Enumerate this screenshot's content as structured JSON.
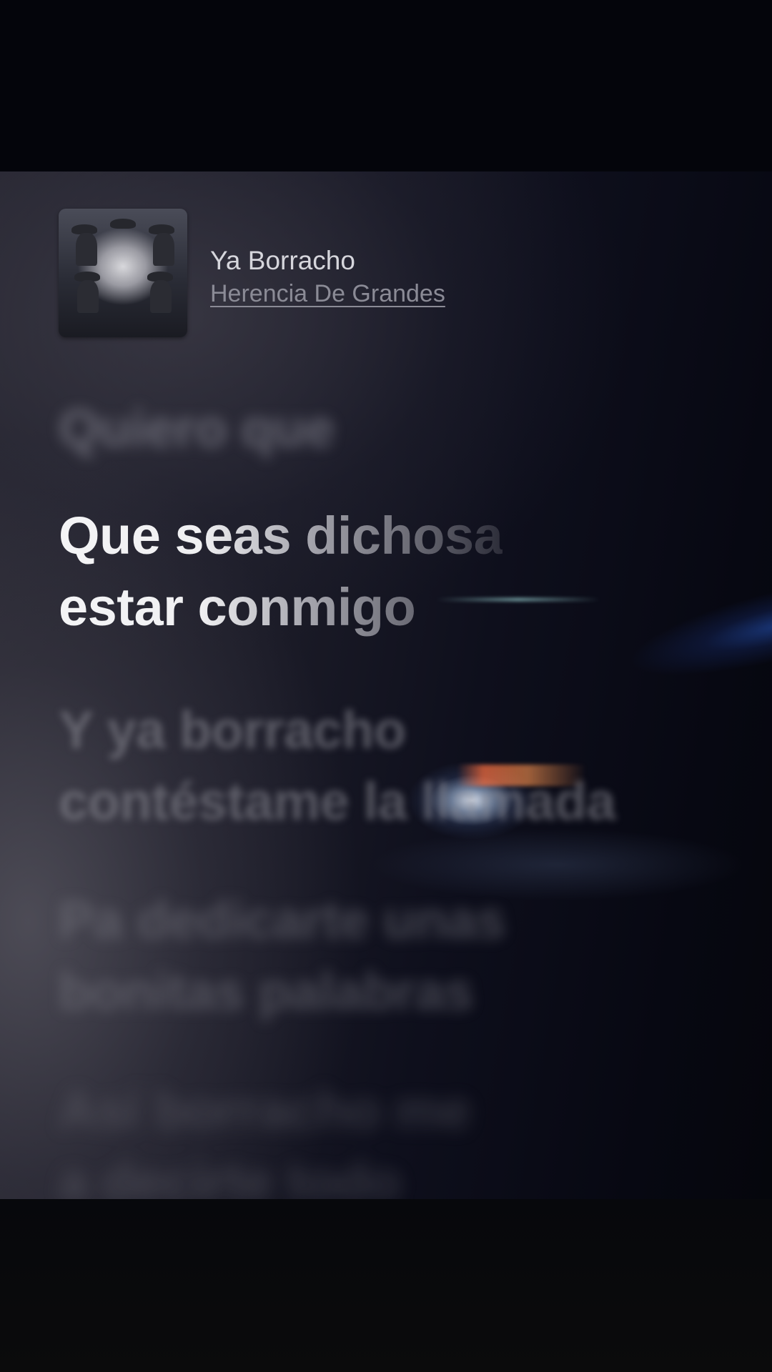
{
  "now_playing": {
    "title": "Ya Borracho",
    "artist": "Herencia De Grandes",
    "album_art_icon": "album-cover-art"
  },
  "lyrics": {
    "previous": [
      "Quiero que"
    ],
    "current": [
      "Que seas dichosa",
      "estar conmigo"
    ],
    "next_1": [
      "Y ya borracho",
      "contéstame la llamada"
    ],
    "next_2": [
      "Pa dedicarte unas",
      "bonitas palabras"
    ],
    "next_3": [
      "Así borracho me",
      "a decirte todo"
    ]
  },
  "colors": {
    "background": "#04050a",
    "active_lyric": "#ffffff",
    "inactive_lyric": "#8c8c96",
    "title_text": "#d6d6dc",
    "artist_text": "#8b8b96"
  }
}
